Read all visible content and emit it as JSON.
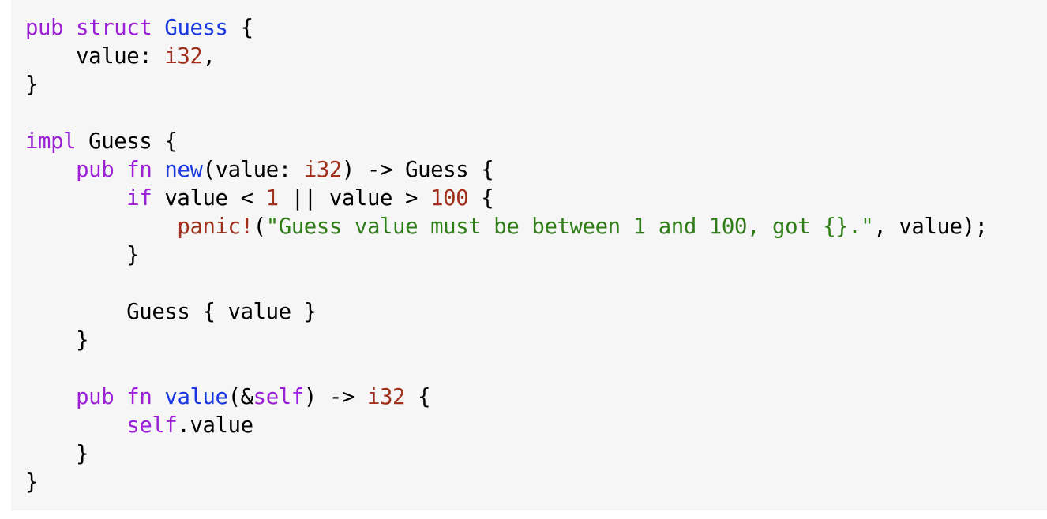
{
  "code": {
    "language": "rust",
    "lines": [
      {
        "tokens": [
          {
            "t": "kw",
            "v": "pub"
          },
          {
            "t": "plain",
            "v": " "
          },
          {
            "t": "kw",
            "v": "struct"
          },
          {
            "t": "plain",
            "v": " "
          },
          {
            "t": "ty",
            "v": "Guess"
          },
          {
            "t": "plain",
            "v": " {"
          }
        ]
      },
      {
        "tokens": [
          {
            "t": "plain",
            "v": "    value: "
          },
          {
            "t": "num",
            "v": "i32"
          },
          {
            "t": "plain",
            "v": ","
          }
        ]
      },
      {
        "tokens": [
          {
            "t": "plain",
            "v": "}"
          }
        ]
      },
      {
        "tokens": [
          {
            "t": "plain",
            "v": ""
          }
        ]
      },
      {
        "tokens": [
          {
            "t": "kw",
            "v": "impl"
          },
          {
            "t": "plain",
            "v": " Guess {"
          }
        ]
      },
      {
        "tokens": [
          {
            "t": "plain",
            "v": "    "
          },
          {
            "t": "kw",
            "v": "pub"
          },
          {
            "t": "plain",
            "v": " "
          },
          {
            "t": "kw",
            "v": "fn"
          },
          {
            "t": "plain",
            "v": " "
          },
          {
            "t": "fn",
            "v": "new"
          },
          {
            "t": "plain",
            "v": "(value: "
          },
          {
            "t": "num",
            "v": "i32"
          },
          {
            "t": "plain",
            "v": ") -> Guess {"
          }
        ]
      },
      {
        "tokens": [
          {
            "t": "plain",
            "v": "        "
          },
          {
            "t": "kw",
            "v": "if"
          },
          {
            "t": "plain",
            "v": " value < "
          },
          {
            "t": "num",
            "v": "1"
          },
          {
            "t": "plain",
            "v": " || value > "
          },
          {
            "t": "num",
            "v": "100"
          },
          {
            "t": "plain",
            "v": " {"
          }
        ]
      },
      {
        "tokens": [
          {
            "t": "plain",
            "v": "            "
          },
          {
            "t": "mac",
            "v": "panic!"
          },
          {
            "t": "plain",
            "v": "("
          },
          {
            "t": "str",
            "v": "\"Guess value must be between 1 and 100, got {}.\""
          },
          {
            "t": "plain",
            "v": ", value);"
          }
        ]
      },
      {
        "tokens": [
          {
            "t": "plain",
            "v": "        }"
          }
        ]
      },
      {
        "tokens": [
          {
            "t": "plain",
            "v": ""
          }
        ]
      },
      {
        "tokens": [
          {
            "t": "plain",
            "v": "        Guess { value }"
          }
        ]
      },
      {
        "tokens": [
          {
            "t": "plain",
            "v": "    }"
          }
        ]
      },
      {
        "tokens": [
          {
            "t": "plain",
            "v": ""
          }
        ]
      },
      {
        "tokens": [
          {
            "t": "plain",
            "v": "    "
          },
          {
            "t": "kw",
            "v": "pub"
          },
          {
            "t": "plain",
            "v": " "
          },
          {
            "t": "kw",
            "v": "fn"
          },
          {
            "t": "plain",
            "v": " "
          },
          {
            "t": "fn",
            "v": "value"
          },
          {
            "t": "plain",
            "v": "(&"
          },
          {
            "t": "kw",
            "v": "self"
          },
          {
            "t": "plain",
            "v": ") -> "
          },
          {
            "t": "num",
            "v": "i32"
          },
          {
            "t": "plain",
            "v": " {"
          }
        ]
      },
      {
        "tokens": [
          {
            "t": "plain",
            "v": "        "
          },
          {
            "t": "kw",
            "v": "self"
          },
          {
            "t": "plain",
            "v": ".value"
          }
        ]
      },
      {
        "tokens": [
          {
            "t": "plain",
            "v": "    }"
          }
        ]
      },
      {
        "tokens": [
          {
            "t": "plain",
            "v": "}"
          }
        ]
      }
    ]
  },
  "colors": {
    "background": "#f6f6f6",
    "keyword": "#9b1fd6",
    "type_or_function": "#1a38e0",
    "number_or_macro": "#a0301c",
    "string": "#2e7d17",
    "plain": "#000000"
  }
}
